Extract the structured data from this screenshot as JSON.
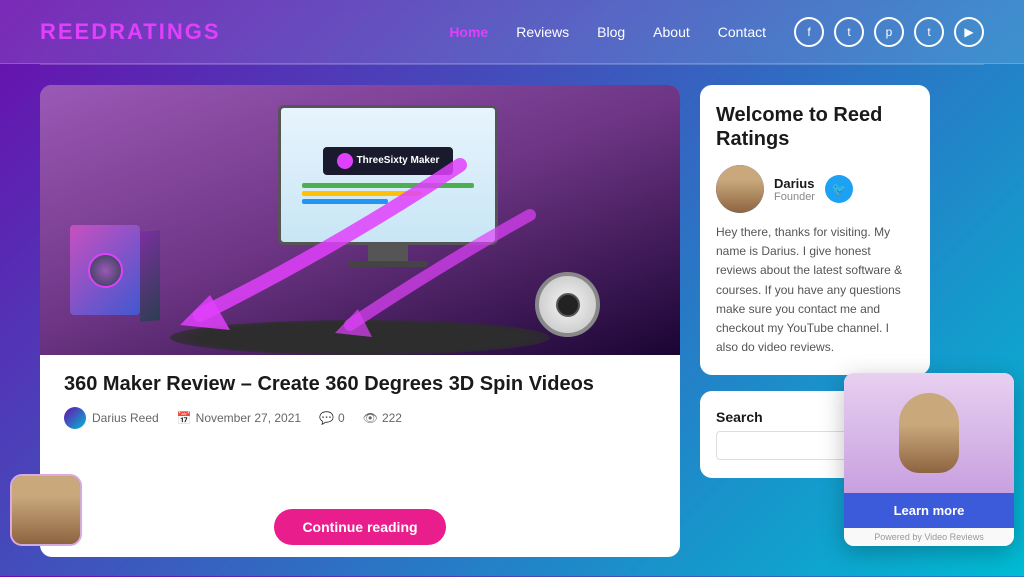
{
  "header": {
    "logo_text": "ReedRatings",
    "logo_r": "R",
    "nav_items": [
      {
        "label": "Home",
        "active": true
      },
      {
        "label": "Reviews",
        "active": false
      },
      {
        "label": "Blog",
        "active": false
      },
      {
        "label": "About",
        "active": false
      },
      {
        "label": "Contact",
        "active": false
      }
    ],
    "social_icons": [
      "f",
      "t",
      "p",
      "t",
      "yt"
    ]
  },
  "article": {
    "title": "360 Maker Review – Create 360 Degrees 3D Spin Videos",
    "author": "Darius Reed",
    "date": "November 27, 2021",
    "comments": "0",
    "views": "222",
    "continue_btn_label": "Continue reading",
    "product_label": "ThreeSixty Maker"
  },
  "sidebar": {
    "welcome_title": "Welcome to Reed Ratings",
    "author_name": "Darius",
    "author_role": "Founder",
    "author_text": "Hey there, thanks for visiting. My name is Darius. I give honest reviews about the latest software & courses. If you have any questions make sure you contact me and checkout my YouTube channel. I also do video reviews.",
    "search_label": "Search",
    "search_placeholder": ""
  },
  "video_widget": {
    "learn_more_label": "Learn more",
    "powered_by": "Powered by Video Reviews"
  }
}
